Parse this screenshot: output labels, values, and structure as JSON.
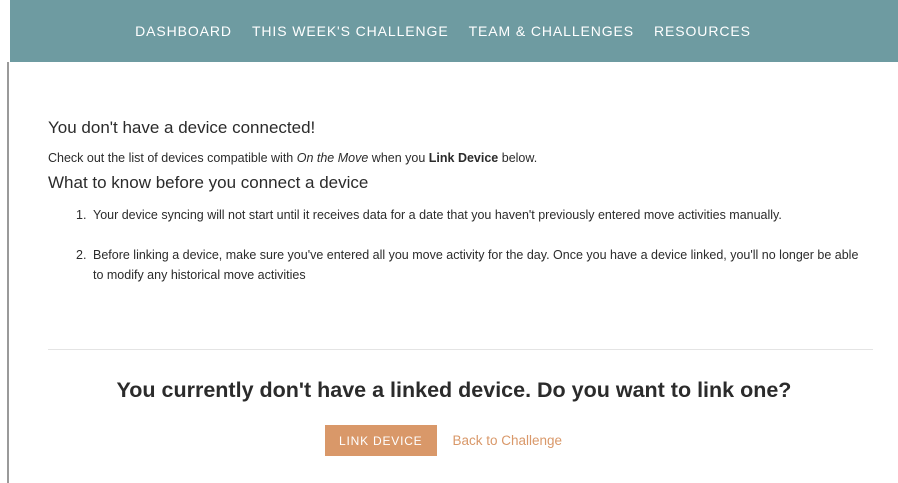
{
  "nav": {
    "items": [
      {
        "label": "DASHBOARD"
      },
      {
        "label": "THIS WEEK'S CHALLENGE"
      },
      {
        "label": "TEAM & CHALLENGES"
      },
      {
        "label": "RESOURCES"
      }
    ]
  },
  "main": {
    "heading": "You don't have a device connected!",
    "intro": {
      "prefix": "Check out the list of devices compatible with ",
      "program_name": "On the Move",
      "middle": " when you ",
      "action_name": "Link Device",
      "suffix": " below."
    },
    "know_heading": "What to know before you connect a device",
    "steps": [
      {
        "number": "1.",
        "text": "Your device syncing will not start until it receives data for a date that you haven't previously entered move activities manually."
      },
      {
        "number": "2.",
        "text": "Before linking a device, make sure you've entered all you move activity for the day. Once you have a device linked, you'll no longer be able to modify any historical move activities"
      }
    ],
    "prompt": "You currently don't have a linked device. Do you want to link one?",
    "link_button": "LINK DEVICE",
    "back_link": "Back to Challenge"
  },
  "colors": {
    "nav_background": "#6e9ba1",
    "accent": "#d99869"
  }
}
